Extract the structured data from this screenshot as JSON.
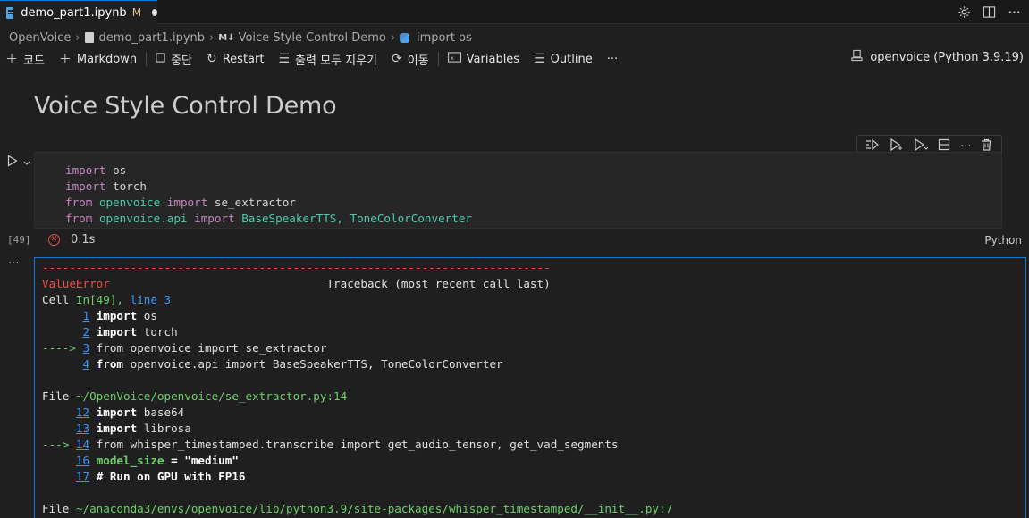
{
  "tabs": [
    {
      "title": "demo_part1.ipynb",
      "modified": "M"
    }
  ],
  "breadcrumb": {
    "root": "OpenVoice",
    "file": "demo_part1.ipynb",
    "section": "Voice Style Control Demo",
    "symbol": "import os"
  },
  "toolbar": {
    "code": "코드",
    "markdown": "Markdown",
    "interrupt": "중단",
    "restart": "Restart",
    "clear_outputs": "출력 모두 지우기",
    "goto": "이동",
    "variables": "Variables",
    "outline": "Outline",
    "more": "···",
    "kernel": "openvoice (Python 3.9.19)"
  },
  "heading": "Voice Style Control Demo",
  "cell": {
    "execution_count": "[49]",
    "duration": "0.1s",
    "language": "Python",
    "code_lines": [
      [
        "import",
        "os"
      ],
      [
        "import",
        "torch"
      ],
      [
        "from",
        "openvoice",
        "import",
        "se_extractor"
      ],
      [
        "from",
        "openvoice.api",
        "import",
        "BaseSpeakerTTS, ToneColorConverter"
      ]
    ]
  },
  "output": {
    "dashes": "---------------------------------------------------------------------------",
    "error_name": "ValueError",
    "traceback_header": "Traceback (most recent call last)",
    "cell_label": "Cell",
    "cell_ref": "In[49], ",
    "cell_line_link": "line 3",
    "frame1": [
      {
        "arrow": "",
        "num": "1",
        "kw": "import",
        "rest": " os"
      },
      {
        "arrow": "",
        "num": "2",
        "kw": "import",
        "rest": " torch"
      },
      {
        "arrow": "---->",
        "num": "3",
        "kw": "",
        "rest": "from openvoice import se_extractor"
      },
      {
        "arrow": "",
        "num": "4",
        "kw": "from",
        "rest": " openvoice.api import BaseSpeakerTTS, ToneColorConverter"
      }
    ],
    "file1_label": "File",
    "file1_path": "~/OpenVoice/openvoice/se_extractor.py:14",
    "frame2": [
      {
        "arrow": "",
        "num": "12",
        "kw": "import",
        "rest": " base64"
      },
      {
        "arrow": "",
        "num": "13",
        "kw": "import",
        "rest": " librosa"
      },
      {
        "arrow": "--->",
        "num": "14",
        "kw": "",
        "rest": "from whisper_timestamped.transcribe import get_audio_tensor, get_vad_segments"
      },
      {
        "arrow": "",
        "num": "16",
        "kw": "model_size",
        "rest": " = \"medium\""
      },
      {
        "arrow": "",
        "num": "17",
        "kw": "# Run on GPU with FP16",
        "rest": ""
      }
    ],
    "file2_label": "File",
    "file2_path": "~/anaconda3/envs/openvoice/lib/python3.9/site-packages/whisper_timestamped/__init__.py:7"
  }
}
